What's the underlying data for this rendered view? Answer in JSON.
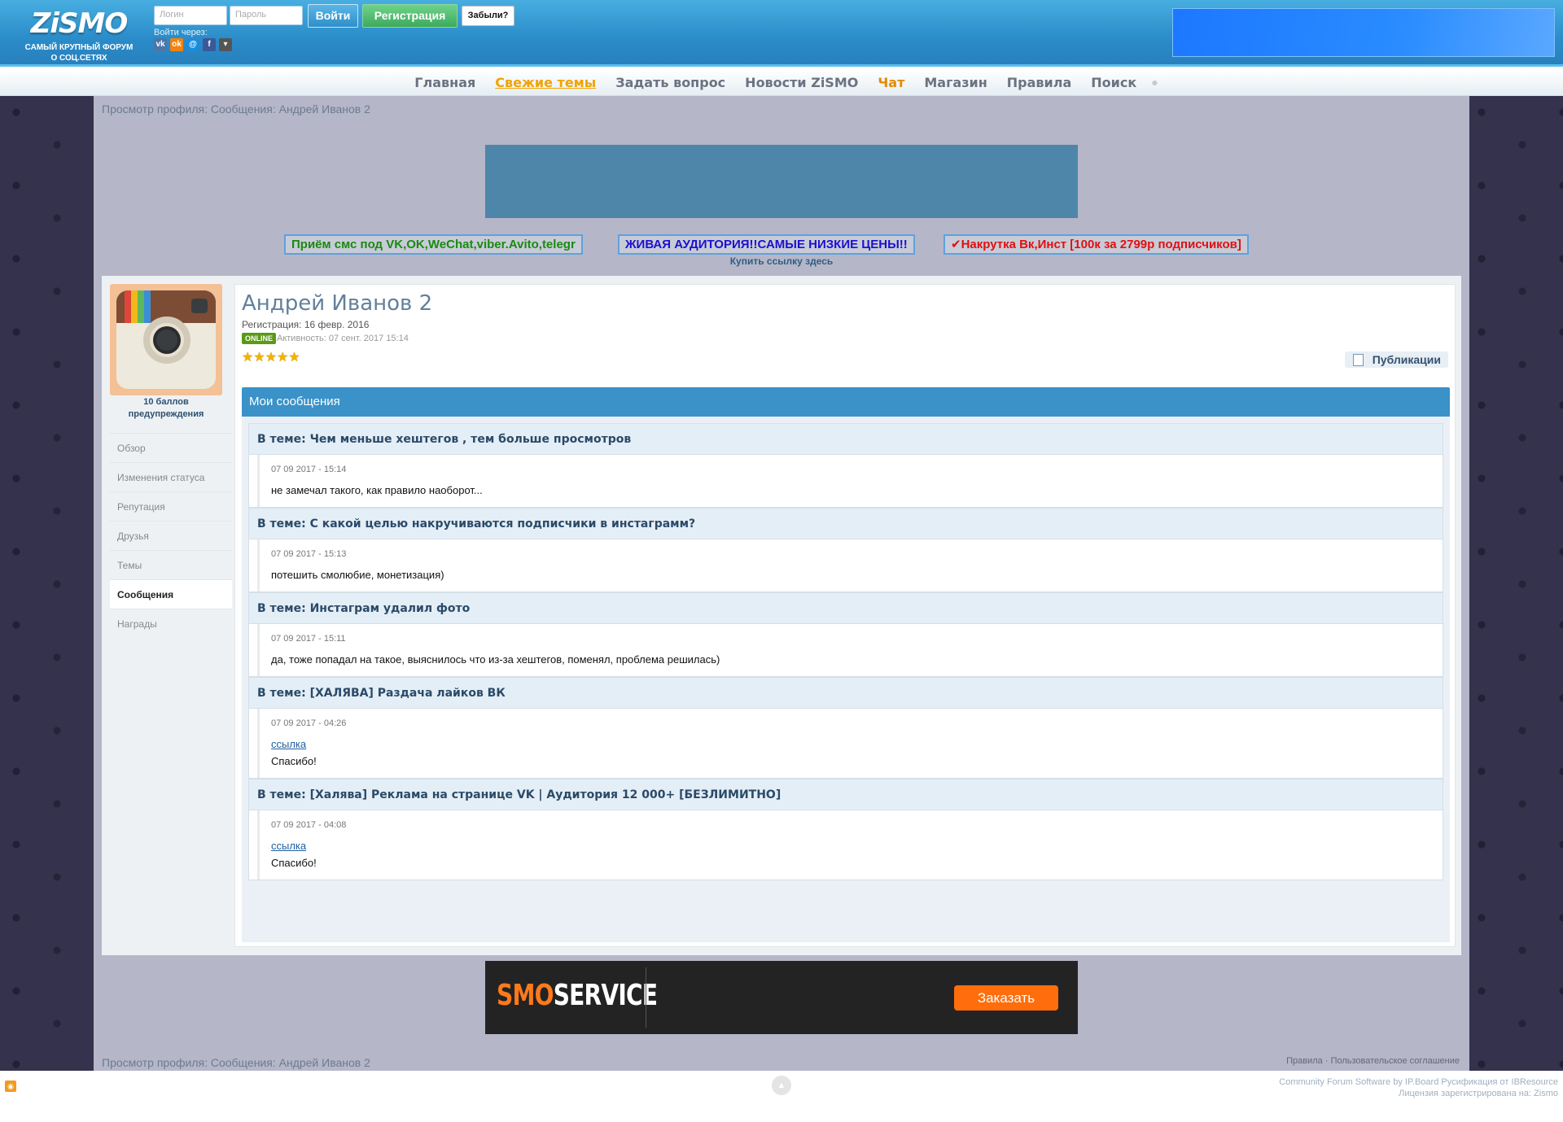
{
  "header": {
    "brand": "ZiSMO",
    "slogan_line1": "САМЫЙ КРУПНЫЙ ФОРУМ",
    "slogan_line2": "О СОЦ.СЕТЯХ",
    "login_placeholder": "Логин",
    "password_placeholder": "Пароль",
    "login_button": "Войти",
    "register_button": "Регистрация",
    "forgot_button": "Забыли?",
    "login_via": "Войти через:",
    "social": [
      "vk-icon",
      "odnoklassniki-icon",
      "mailru-icon",
      "facebook-icon",
      "more-icon"
    ]
  },
  "nav": {
    "items": [
      "Главная",
      "Свежие темы",
      "Задать вопрос",
      "Новости ZiSMO",
      "Чат",
      "Магазин",
      "Правила",
      "Поиск"
    ]
  },
  "breadcrumb": "Просмотр профиля: Сообщения: Андрей Иванов 2",
  "promos": [
    {
      "text": "Приём смс под VK,OK,WeChat,viber.Avito,telegr",
      "color": "#1a8a10"
    },
    {
      "text": "ЖИВАЯ АУДИТОРИЯ!!САМЫЕ НИЗКИЕ ЦЕНЫ!!",
      "color": "#1a10d0"
    },
    {
      "text": "✔Накрутка Вк,Инст [100к за 2799р подписчиков]",
      "color": "#e01010"
    }
  ],
  "buy_link": "Купить ссылку здесь",
  "profile": {
    "warnings_line1": "10 баллов",
    "warnings_line2": "предупреждения",
    "menu": [
      "Обзор",
      "Изменения статуса",
      "Репутация",
      "Друзья",
      "Темы",
      "Сообщения",
      "Награды"
    ],
    "active_menu": "Сообщения",
    "name": "Андрей Иванов 2",
    "registered": "Регистрация: 16 февр. 2016",
    "status": "ONLINE",
    "activity": "Активность: 07 сент. 2017 15:14",
    "rating_stars": 5,
    "publications_button": "Публикации",
    "section_title": "Мои сообщения"
  },
  "posts": [
    {
      "title": "В теме: Чем меньше хештегов , тем больше просмотров",
      "date": "07 09 2017 - 15:14",
      "link": "",
      "text": "не замечал такого, как правило наоборот..."
    },
    {
      "title": "В теме: С какой целью накручиваются подписчики в инстаграмм?",
      "date": "07 09 2017 - 15:13",
      "link": "",
      "text": "потешить смолюбие, монетизация)"
    },
    {
      "title": "В теме: Инстаграм удалил фото",
      "date": "07 09 2017 - 15:11",
      "link": "",
      "text": "да, тоже попадал на такое, выяснилось что из-за хештегов, поменял, проблема решилась)"
    },
    {
      "title": "В теме: [ХАЛЯВА] Раздача лайков ВК",
      "date": "07 09 2017 - 04:26",
      "link": "ссылка",
      "text": "Спасибо!"
    },
    {
      "title": "В теме: [Халява] Реклама на странице VK | Аудитория 12 000+ [БЕЗЛИМИТНО]",
      "date": "07 09 2017 - 04:08",
      "link": "ссылка",
      "text": "Спасибо!"
    }
  ],
  "ad_bottom": {
    "brand_a": "SMO",
    "brand_b": "SERVICE",
    "button": "Заказать"
  },
  "footer": {
    "rules": "Правила",
    "agreement": "Пользовательское соглашение",
    "credits_line1": "Community Forum Software by IP.Board Русификация от IBResource",
    "credits_line2": "Лицензия зарегистрирована на: Zismo"
  },
  "colors": {
    "header_blue": "#2a8cc9",
    "accent_blue": "#3a92c8",
    "fresh_topics": "#f0a400",
    "chat": "#e58b00",
    "online_green": "#5a9a16"
  }
}
